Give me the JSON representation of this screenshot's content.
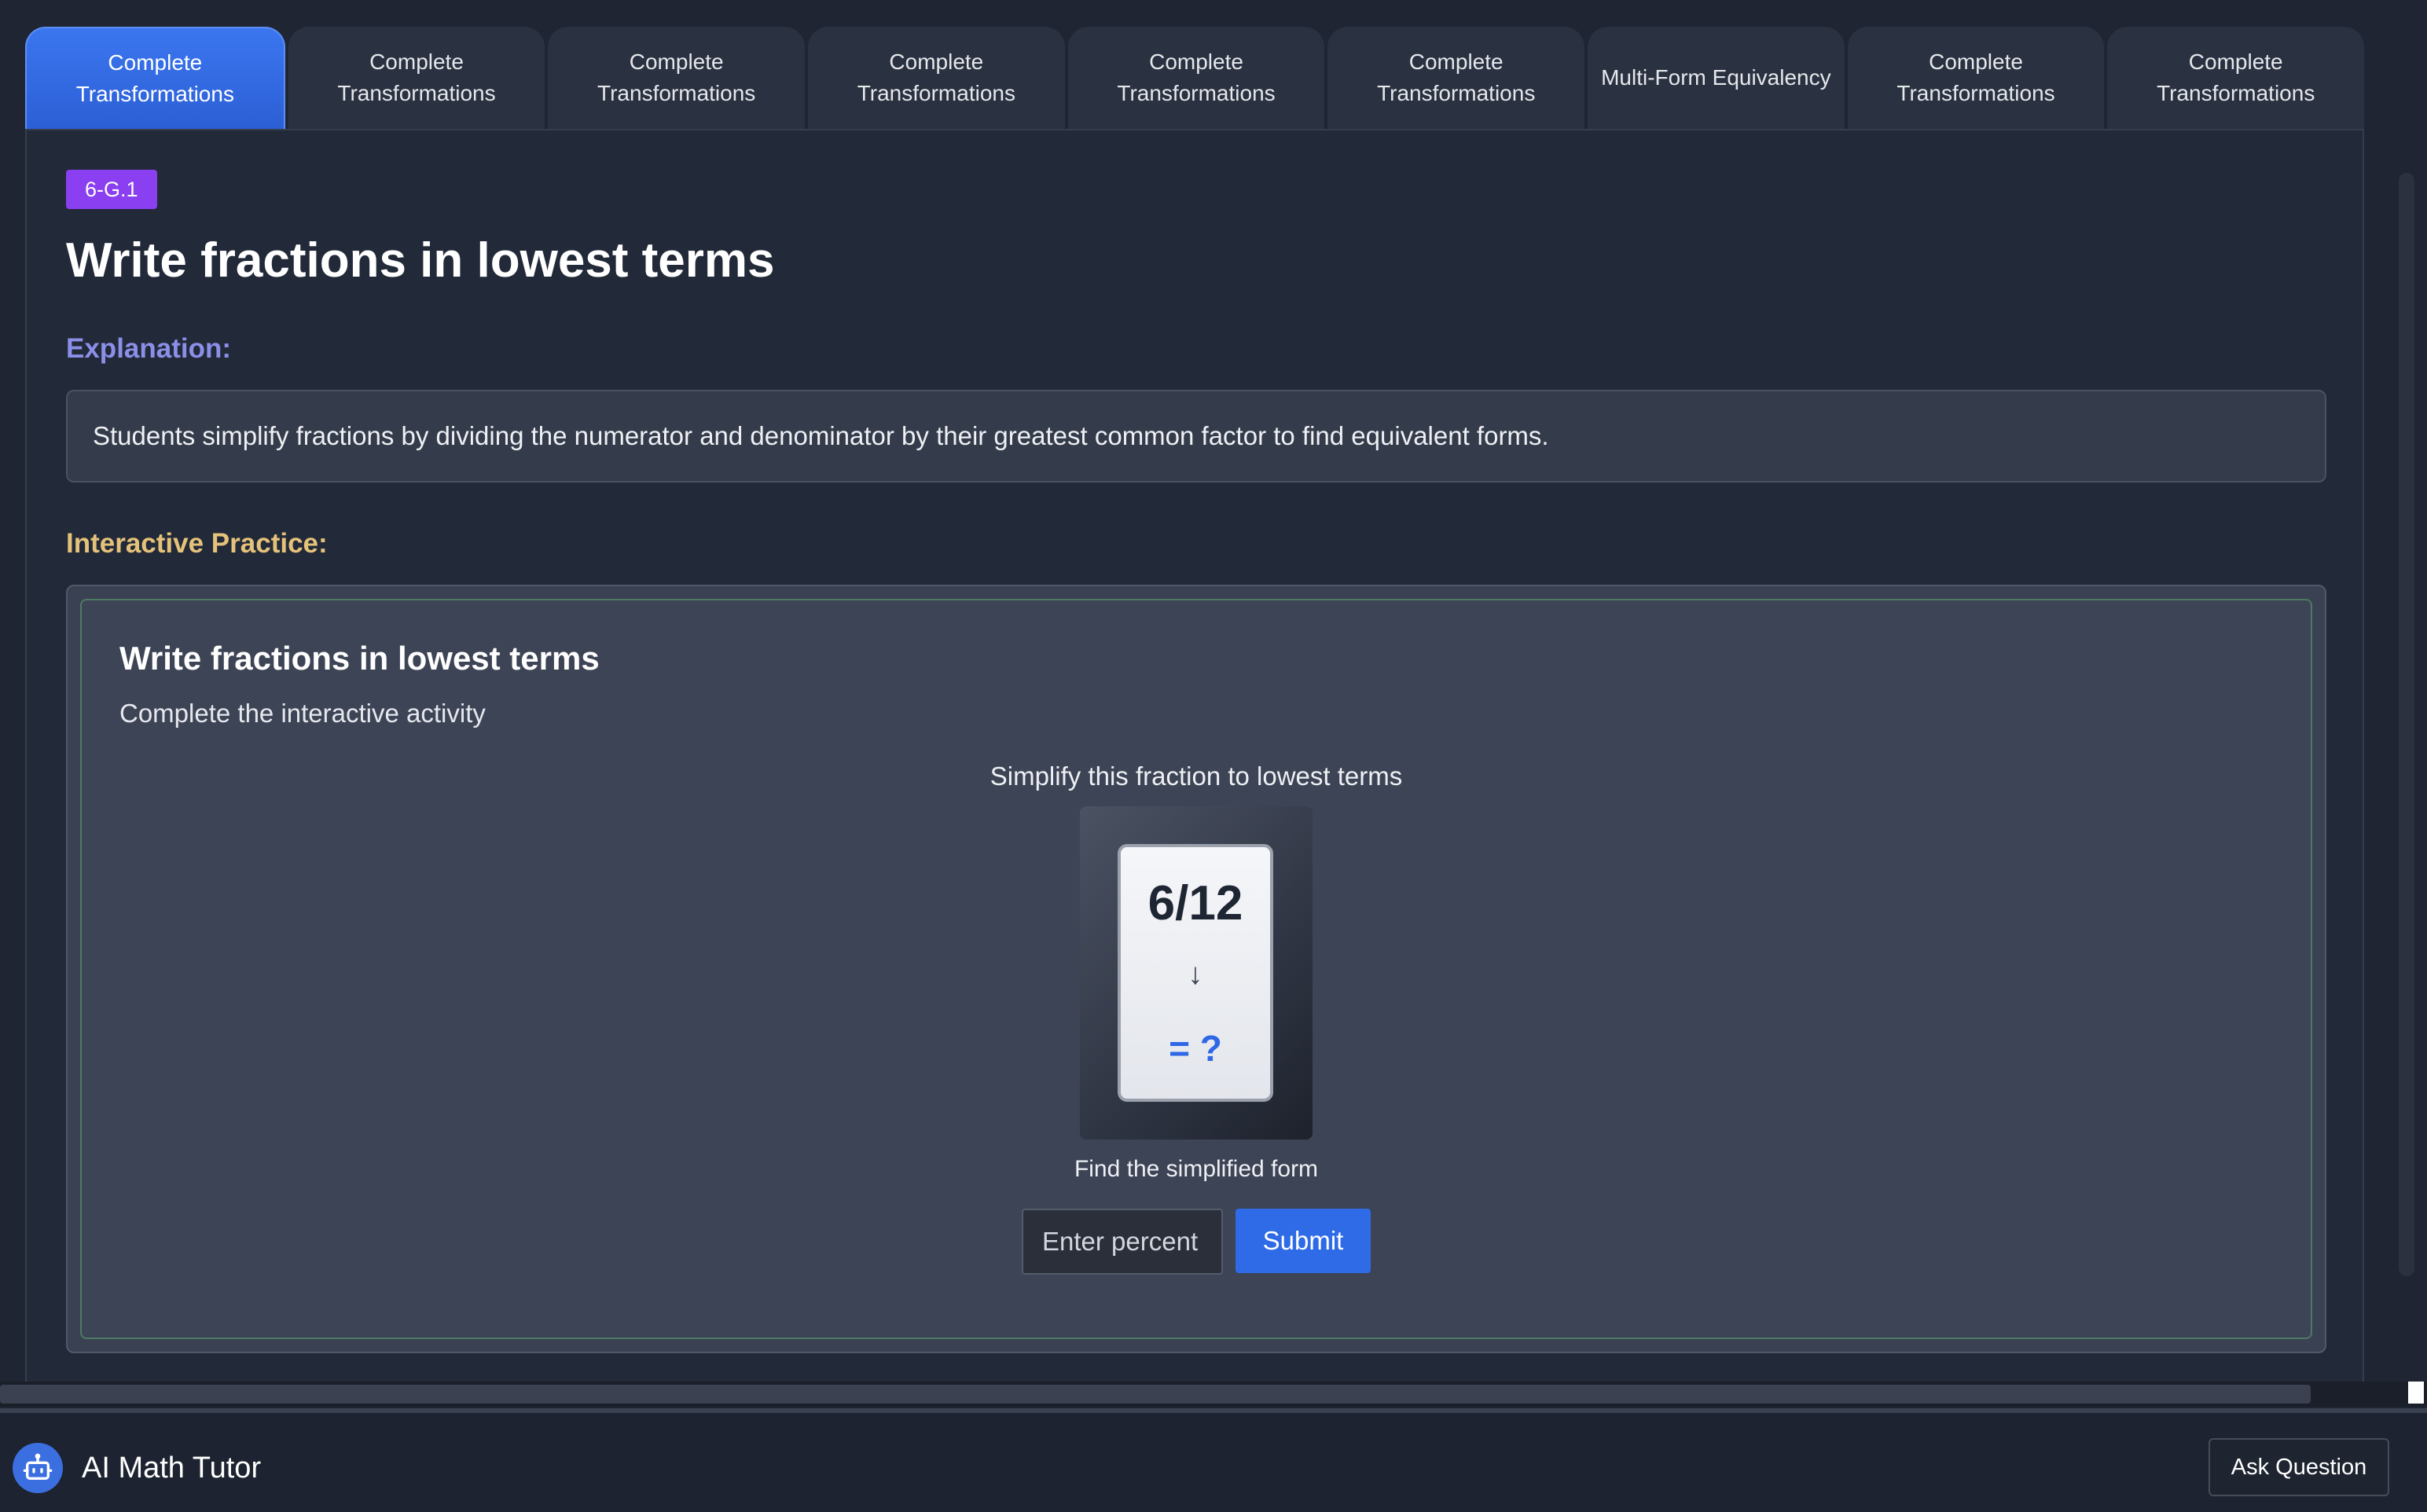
{
  "tabs": [
    {
      "label": "Complete Transformations",
      "active": true
    },
    {
      "label": "Complete Transformations",
      "active": false
    },
    {
      "label": "Complete Transformations",
      "active": false
    },
    {
      "label": "Complete Transformations",
      "active": false
    },
    {
      "label": "Complete Transformations",
      "active": false
    },
    {
      "label": "Complete Transformations",
      "active": false
    },
    {
      "label": "Multi-Form Equivalency",
      "active": false
    },
    {
      "label": "Complete Transformations",
      "active": false
    },
    {
      "label": "Complete Transformations",
      "active": false
    }
  ],
  "lesson": {
    "badge": "6-G.1",
    "title": "Write fractions in lowest terms",
    "explanation_label": "Explanation:",
    "explanation": "Students simplify fractions by dividing the numerator and denominator by their greatest common factor to find equivalent forms.",
    "practice_label": "Interactive Practice:"
  },
  "activity": {
    "title": "Write fractions in lowest terms",
    "subtitle": "Complete the interactive activity",
    "prompt": "Simplify this fraction to lowest terms",
    "fraction": "6/12",
    "arrow": "↓",
    "answer": "= ?",
    "hint": "Find the simplified form",
    "input_placeholder": "Enter percent",
    "input_value": "",
    "submit_label": "Submit"
  },
  "footer": {
    "tutor_label": "AI Math Tutor",
    "ask_label": "Ask Question",
    "bot_icon": "robot-icon"
  },
  "colors": {
    "accent": "#2f6be6",
    "badge": "#8a3ff0",
    "explanation_heading": "#8b8fe8",
    "practice_heading": "#e5c27a"
  }
}
